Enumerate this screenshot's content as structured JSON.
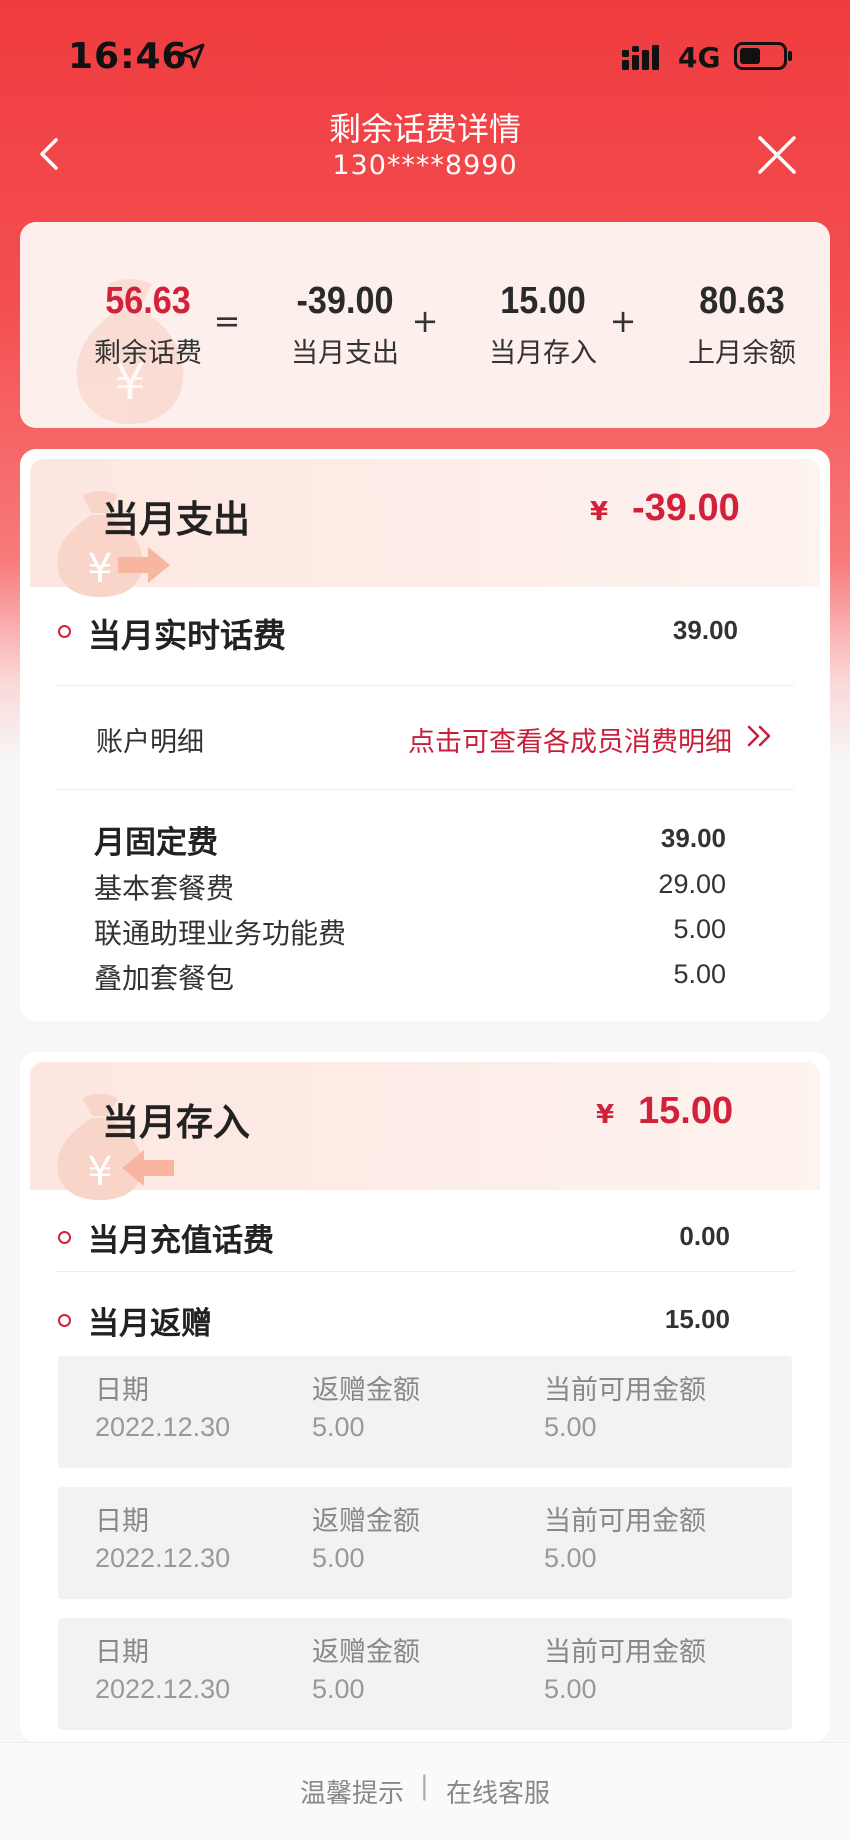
{
  "status": {
    "time": "16:46",
    "network": "4G",
    "icons": [
      "location-arrow-icon",
      "signal-icon",
      "battery-icon"
    ]
  },
  "header": {
    "title": "剩余话费详情",
    "phone": "130****8990",
    "icons": [
      "back-chevron-icon",
      "close-icon"
    ]
  },
  "summary": {
    "remaining": {
      "value": "56.63",
      "label": "剩余话费"
    },
    "eq": "=",
    "expense": {
      "value": "-39.00",
      "label": "当月支出"
    },
    "plus1": "+",
    "deposit": {
      "value": "15.00",
      "label": "当月存入"
    },
    "plus2": "+",
    "last_balance": {
      "value": "80.63",
      "label": "上月余额"
    }
  },
  "expense_section": {
    "title": "当月支出",
    "currency": "¥",
    "amount": "-39.00",
    "realtime": {
      "label": "当月实时话费",
      "value": "39.00"
    },
    "account_detail": {
      "label": "账户明细",
      "link": "点击可查看各成员消费明细"
    },
    "fixed_fee": {
      "label": "月固定费",
      "value": "39.00"
    },
    "fee_items": [
      {
        "label": "基本套餐费",
        "value": "29.00"
      },
      {
        "label": "联通助理业务功能费",
        "value": "5.00"
      },
      {
        "label": "叠加套餐包",
        "value": "5.00"
      }
    ]
  },
  "deposit_section": {
    "title": "当月存入",
    "currency": "¥",
    "amount": "15.00",
    "recharge": {
      "label": "当月充值话费",
      "value": "0.00"
    },
    "rebate": {
      "label": "当月返赠",
      "value": "15.00"
    },
    "record_headers": [
      "日期",
      "返赠金额",
      "当前可用金额"
    ],
    "records": [
      {
        "date": "2022.12.30",
        "rebate": "5.00",
        "available": "5.00"
      },
      {
        "date": "2022.12.30",
        "rebate": "5.00",
        "available": "5.00"
      },
      {
        "date": "2022.12.30",
        "rebate": "5.00",
        "available": "5.00"
      }
    ]
  },
  "footer": {
    "tips": "温馨提示",
    "separator": "|",
    "service": "在线客服"
  },
  "colors": {
    "brand_red": "#d2213a",
    "header_red": "#ef3c3f"
  }
}
